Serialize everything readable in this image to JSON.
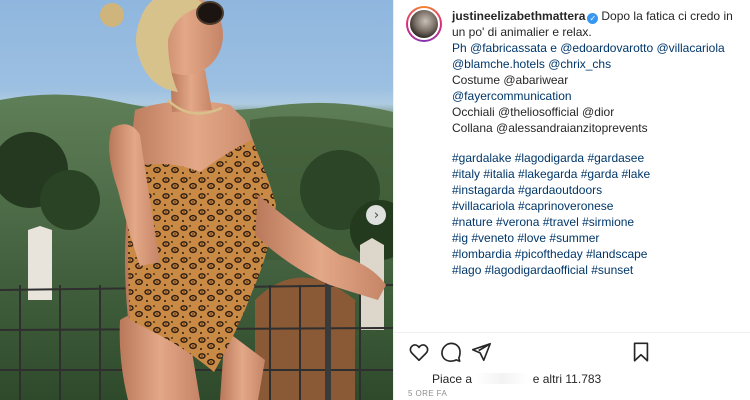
{
  "post": {
    "username": "justineelizabethmattera",
    "caption_lines": [
      "Dopo la fatica ci credo in un po' di animalier e relax.",
      "Ph @fabricassata e @edoardovarotto @villacariola @blamche.hotels @chrix_chs",
      "Costume @abariwear",
      "@fayercommunication",
      "Occhiali @theliosofficial @dior",
      "Collana @alessandraianzitoprevents"
    ],
    "hashtags": [
      "#gardalake #lagodigarda #gardasee",
      "#italy #italia #lakegarda #garda #lake",
      "#instagarda #gardaoutdoors",
      "#villacariola #caprinoveronese",
      "#nature #verona #travel #sirmione",
      "#ig #veneto #love #summer",
      "#lombardia #picoftheday #landscape",
      "#lago #lagodigardaofficial #sunset"
    ],
    "likes_prefix": "Piace a",
    "likes_suffix": "e altri 11.783",
    "timestamp": "5 ORE FA"
  },
  "icons": {
    "verified": "verified-badge-icon",
    "next": "chevron-right-icon",
    "like": "heart-icon",
    "comment": "comment-bubble-icon",
    "share": "paper-plane-icon",
    "save": "bookmark-icon"
  },
  "colors": {
    "link": "#00376b",
    "verified": "#3897f0",
    "muted": "#8e8e8e",
    "text": "#262626"
  }
}
